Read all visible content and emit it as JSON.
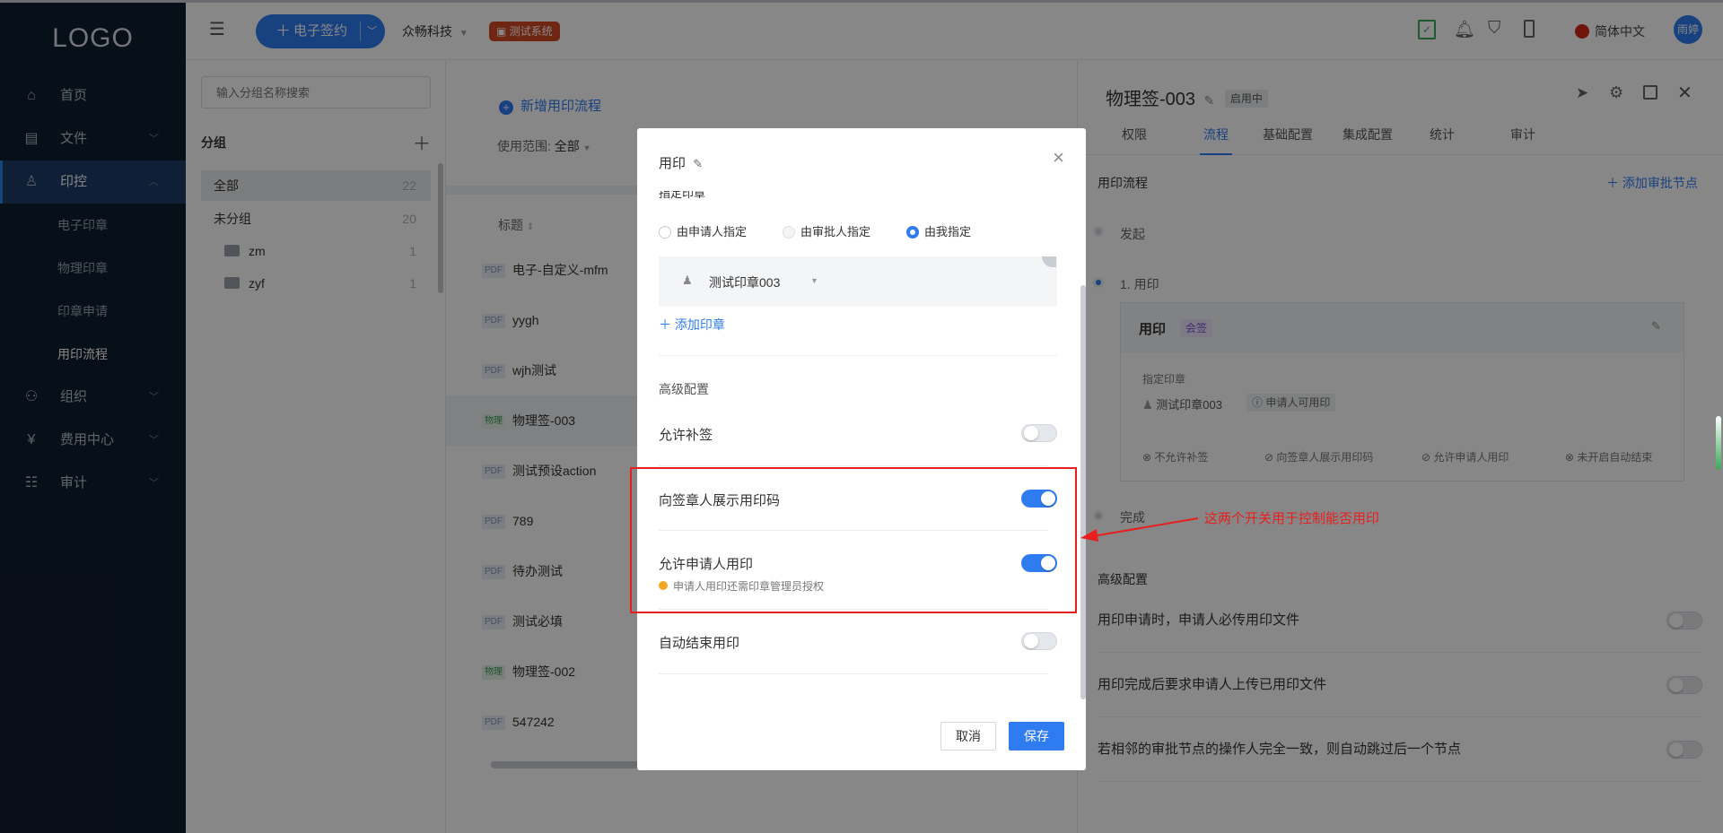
{
  "sidebar": {
    "logo": "LOGO",
    "items": [
      {
        "label": "首页",
        "icon": "home-icon"
      },
      {
        "label": "文件",
        "icon": "file-icon"
      },
      {
        "label": "印控",
        "icon": "seal-user-icon"
      },
      {
        "label": "组织",
        "icon": "org-icon"
      },
      {
        "label": "费用中心",
        "icon": "fee-icon"
      },
      {
        "label": "审计",
        "icon": "audit-icon"
      }
    ],
    "sub_items": [
      "电子印章",
      "物理印章",
      "印章申请",
      "用印流程"
    ]
  },
  "header": {
    "sign_button": "电子签约",
    "company": "众畅科技",
    "system_tag": "测试系统",
    "language": "简体中文",
    "avatar": "雨婷"
  },
  "groups": {
    "search_placeholder": "输入分组名称搜索",
    "title": "分组",
    "rows": [
      {
        "label": "全部",
        "count": "22"
      },
      {
        "label": "未分组",
        "count": "20"
      },
      {
        "label": "zm",
        "count": "1"
      },
      {
        "label": "zyf",
        "count": "1"
      }
    ]
  },
  "list": {
    "add_flow": "新增用印流程",
    "scope_label": "使用范围:",
    "scope_value": "全部",
    "column_title": "标题",
    "rows": [
      {
        "tag": "PDF",
        "title": "电子-自定义-mfm"
      },
      {
        "tag": "PDF",
        "title": "yygh"
      },
      {
        "tag": "PDF",
        "title": "wjh测试"
      },
      {
        "tag": "物理",
        "title": "物理签-003"
      },
      {
        "tag": "PDF",
        "title": "测试预设action"
      },
      {
        "tag": "PDF",
        "title": "789"
      },
      {
        "tag": "PDF",
        "title": "待办测试"
      },
      {
        "tag": "PDF",
        "title": "测试必填"
      },
      {
        "tag": "物理",
        "title": "物理签-002"
      },
      {
        "tag": "PDF",
        "title": "547242"
      }
    ]
  },
  "detail": {
    "title": "物理签-003",
    "status": "启用中",
    "tabs": [
      "权限",
      "流程",
      "基础配置",
      "集成配置",
      "统计",
      "审计"
    ],
    "section_flow": "用印流程",
    "add_node": "添加审批节点",
    "node_start": "发起",
    "node_1": "1. 用印",
    "card_title": "用印",
    "card_tag": "会签",
    "card_sub": "指定印章",
    "card_seal": "测试印章003",
    "card_seal_tag": "申请人可用印",
    "card_flags": [
      "不允许补签",
      "向签章人展示用印码",
      "允许申请人用印",
      "未开启自动结束"
    ],
    "node_end": "完成",
    "section_adv": "高级配置",
    "adv_rows": [
      "用印申请时，申请人必传用印文件",
      "用印完成后要求申请人上传已用印文件",
      "若相邻的审批节点的操作人完全一致，则自动跳过后一个节点"
    ]
  },
  "modal": {
    "title": "用印",
    "cut_label": "指定印章",
    "radios": [
      "由申请人指定",
      "由审批人指定",
      "由我指定"
    ],
    "seal_name": "测试印章003",
    "add_seal": "添加印章",
    "adv_title": "高级配置",
    "allow_supplement": "允许补签",
    "show_code": "向签章人展示用印码",
    "allow_applicant": "允许申请人用印",
    "applicant_hint": "申请人用印还需印章管理员授权",
    "auto_end": "自动结束用印",
    "cancel": "取消",
    "save": "保存"
  },
  "annotation": "这两个开关用于控制能否用印",
  "colors": {
    "accent": "#2f7cf0",
    "annotation": "#e81f1f",
    "warn": "#f5a623"
  }
}
